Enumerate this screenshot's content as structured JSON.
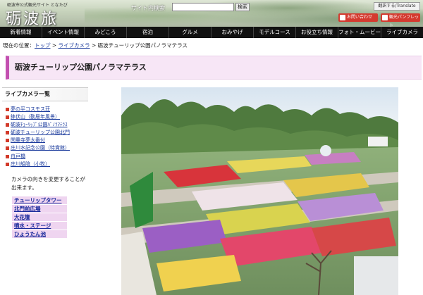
{
  "header": {
    "tagline": "砺波市公式観光サイト となたび",
    "logo": "砺波旅",
    "search_label": "サイト内検索",
    "search_value": "",
    "search_button": "検索",
    "translate_button": "翻訳する/Translate",
    "contact_button": "お問い合わせ",
    "pamphlet_button": "観光パンフレット"
  },
  "nav": [
    "新着情報",
    "イベント情報",
    "みどころ",
    "宿泊",
    "グルメ",
    "おみやげ",
    "モデルコース",
    "お役立ち情報",
    "フォト・ムービー",
    "ライブカメラ"
  ],
  "breadcrumb": {
    "prefix": "現在の位置：",
    "top": "トップ",
    "sep1": " > ",
    "live": "ライブカメラ",
    "sep2": " > ",
    "current": "砺波チューリップ公園パノラマテラス"
  },
  "page_title": "砺波チューリップ公園パノラマテラス",
  "sidebar": {
    "heading": "ライブカメラ一覧",
    "cameras": [
      "夢の平コスモス荘",
      "鉢伏山（勤居年風景）",
      "砺波ﾁｭｰﾘｯﾌﾟ公園ﾊﾟﾉﾗﾏﾃﾗｽ",
      "砺波チューリップ公園北門",
      "閑乗寺夢太番付",
      "庄川水記念公園（特賞館）",
      "舟戸橋",
      "庄川船陰（小牧）"
    ],
    "note": "カメラの向きを変更することが出来ます。",
    "directions": [
      "チューリップタワー",
      "北門前広場",
      "大花壇",
      "噴水・ステージ",
      "ひょうたん池"
    ]
  },
  "colors": {
    "accent": "#c34fb0",
    "title_bg": "#f7e6f6",
    "nav_bg": "#111111",
    "link": "#1a3a9c",
    "bullet": "#d23a2a",
    "pill_red": "#d43a2f"
  },
  "camera_view": {
    "description_icon": "live-camera-image"
  }
}
